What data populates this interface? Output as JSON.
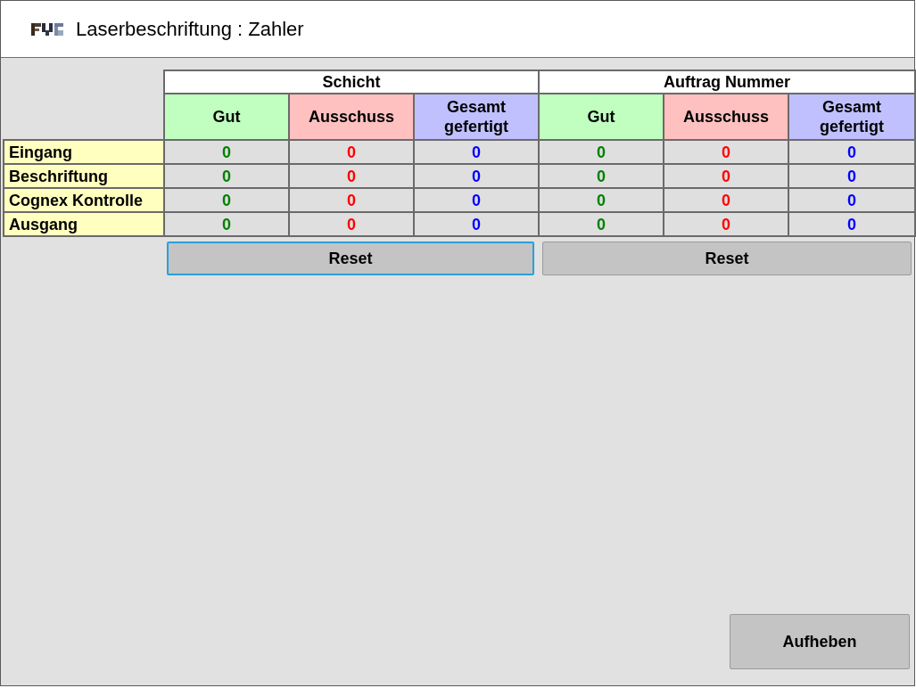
{
  "window": {
    "title": "Laserbeschriftung : Zahler"
  },
  "groups": [
    {
      "title": "Schicht",
      "columns": [
        {
          "label": "Gut",
          "kind": "good"
        },
        {
          "label": "Ausschuss",
          "kind": "reject"
        },
        {
          "label": "Gesamt gefertigt",
          "kind": "total"
        }
      ]
    },
    {
      "title": "Auftrag Nummer",
      "columns": [
        {
          "label": "Gut",
          "kind": "good"
        },
        {
          "label": "Ausschuss",
          "kind": "reject"
        },
        {
          "label": "Gesamt gefertigt",
          "kind": "total"
        }
      ]
    }
  ],
  "rows": [
    {
      "label": "Eingang",
      "cells": [
        "0",
        "0",
        "0",
        "0",
        "0",
        "0"
      ]
    },
    {
      "label": "Beschriftung",
      "cells": [
        "0",
        "0",
        "0",
        "0",
        "0",
        "0"
      ]
    },
    {
      "label": "Cognex Kontrolle",
      "cells": [
        "0",
        "0",
        "0",
        "0",
        "0",
        "0"
      ]
    },
    {
      "label": "Ausgang",
      "cells": [
        "0",
        "0",
        "0",
        "0",
        "0",
        "0"
      ]
    }
  ],
  "reset_buttons": [
    {
      "label": "Reset",
      "focused": true
    },
    {
      "label": "Reset",
      "focused": false
    }
  ],
  "close_button": {
    "label": "Aufheben"
  }
}
